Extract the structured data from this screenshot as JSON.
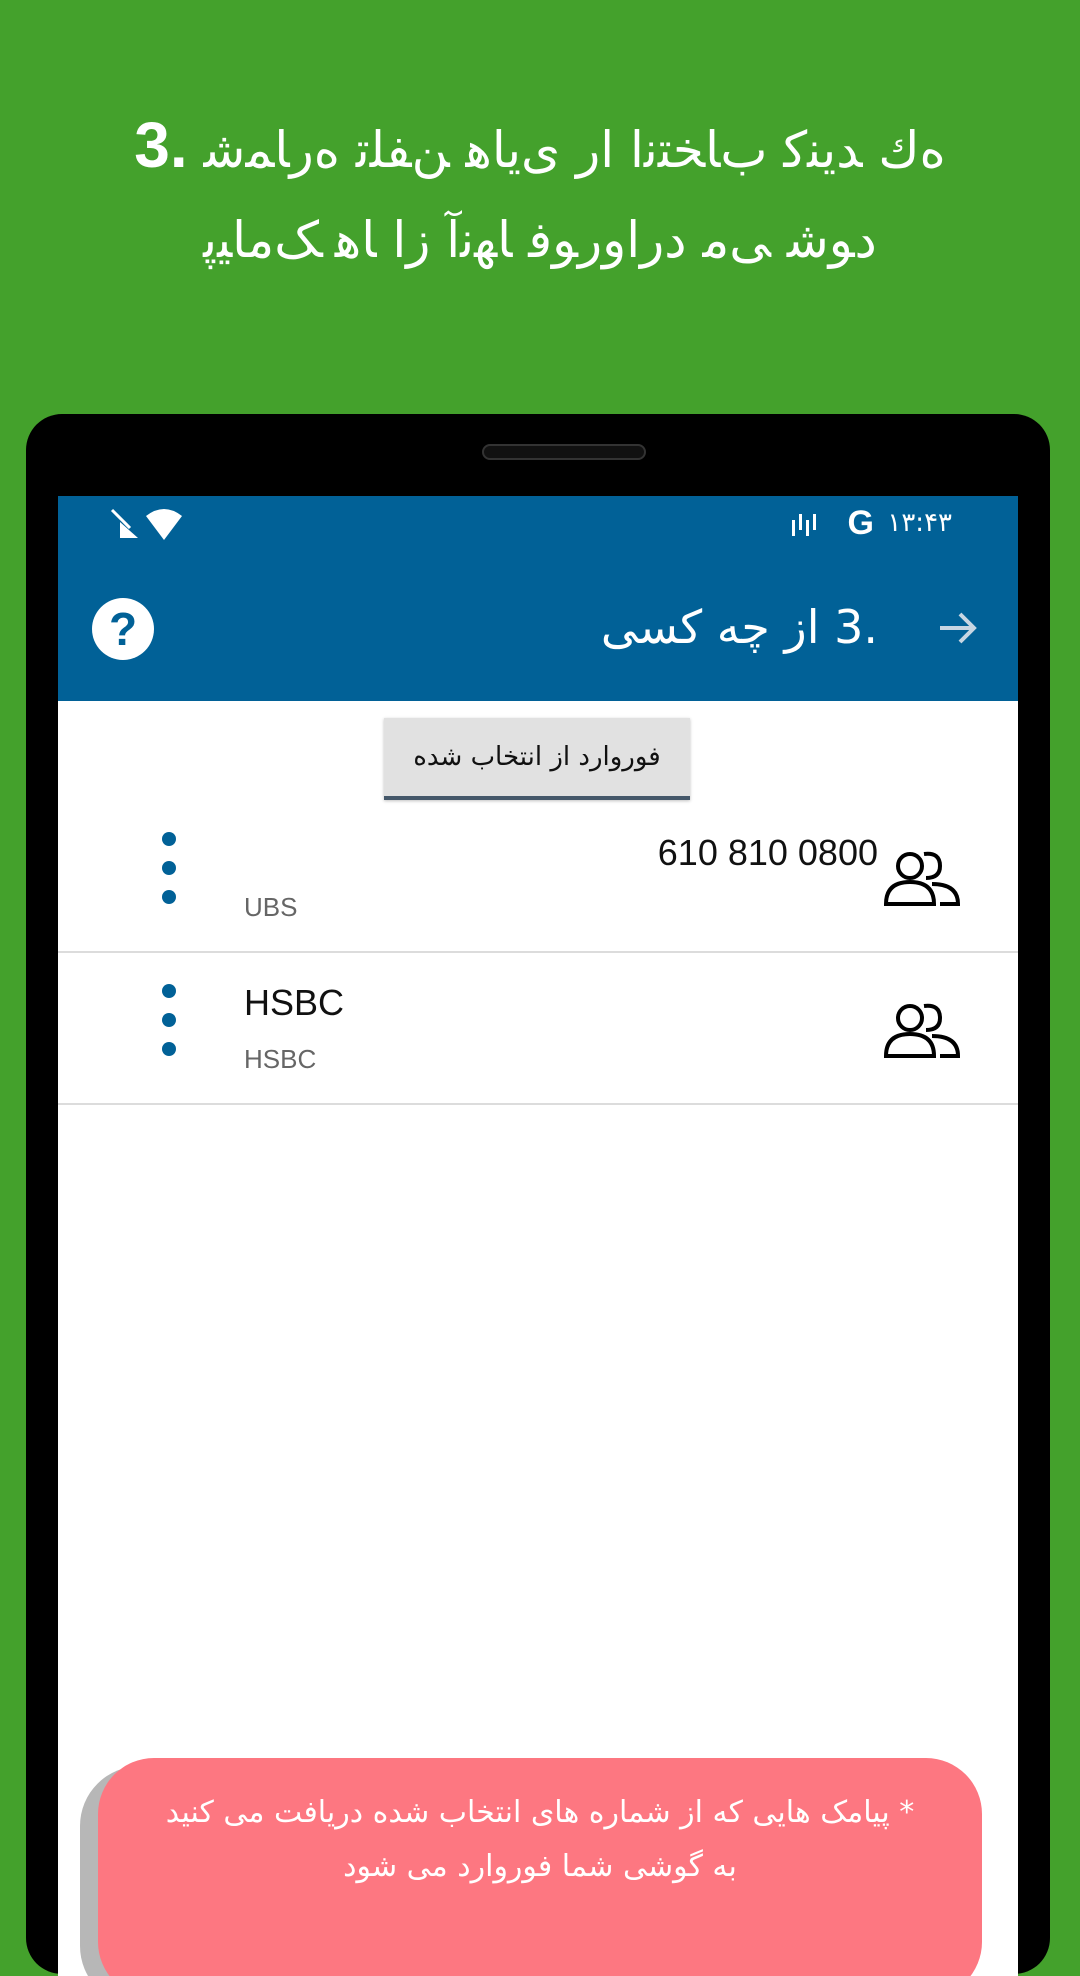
{
  "headline": {
    "number": "3.",
    "line1": "ﻩﻙ ﺪﯾﻨﮐ ﺏﺎﺨﺘﻧﺍ ﺍﺭ ﯼﯾﺎﻫ ﻦﻔﻠﺗ ﻩﺭﺎﻤﺷ",
    "line2": "ﺩﻮﺷ ﯽﻣ ﺩﺭﺍﻭﺭﻮﻓ ﺎﻬﻧﺁ ﺯﺍ ﺎﻫ ﮏﻣﺎﯿﭘ"
  },
  "statusbar": {
    "time": "۱۳:۴۳",
    "g_label": "G"
  },
  "appbar": {
    "title": ".3 از چه کسی",
    "help_symbol": "?"
  },
  "forward_button": {
    "label": "فوروارد از انتخاب شده"
  },
  "contacts": [
    {
      "title": "610 810 0800",
      "subtitle": "UBS"
    },
    {
      "title": "HSBC",
      "subtitle": "HSBC"
    }
  ],
  "toast": {
    "text": "* پیامک هایی که از شماره های انتخاب شده دریافت می کنید به گوشی شما فوروارد می شود"
  },
  "colors": {
    "background_green": "#44a12c",
    "appbar_blue": "#016197",
    "toast_pink": "#fd7781"
  }
}
